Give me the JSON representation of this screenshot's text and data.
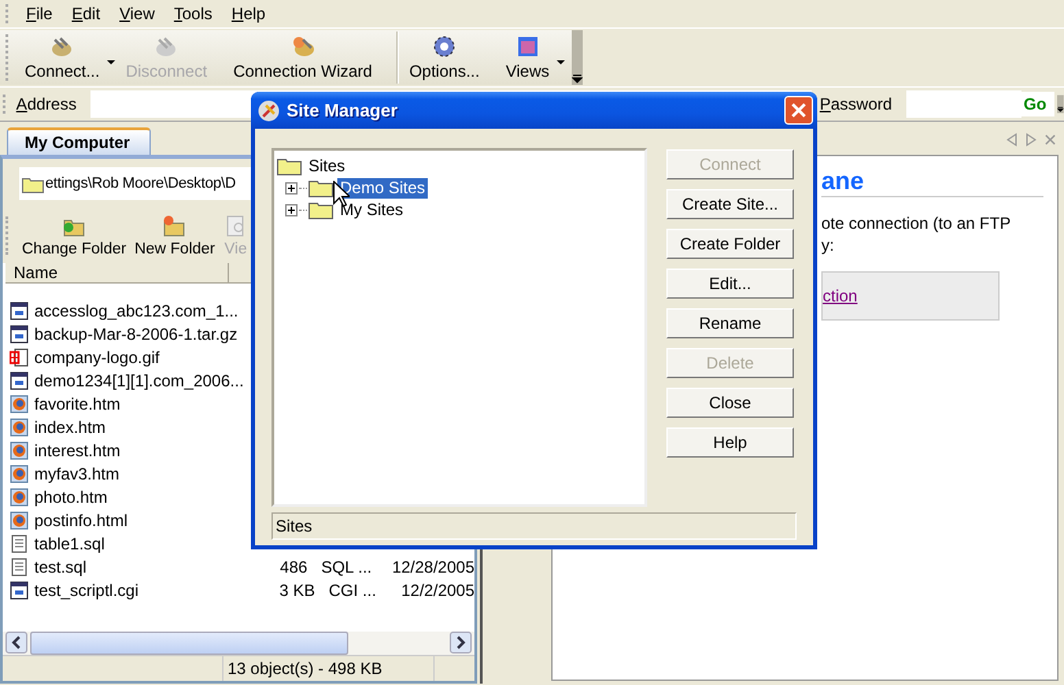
{
  "menu": [
    {
      "label": "File"
    },
    {
      "label": "Edit"
    },
    {
      "label": "View"
    },
    {
      "label": "Tools"
    },
    {
      "label": "Help"
    }
  ],
  "toolbar": [
    {
      "label": "Connect...",
      "kind": "connect",
      "disabled": false,
      "dropdown": true,
      "separator_before": false
    },
    {
      "label": "Disconnect",
      "kind": "disconnect",
      "disabled": true,
      "dropdown": false,
      "separator_before": false
    },
    {
      "label": "Connection Wizard",
      "kind": "wizard",
      "disabled": false,
      "dropdown": false,
      "separator_before": false
    },
    {
      "label": "Options...",
      "kind": "options",
      "disabled": false,
      "dropdown": false,
      "separator_before": true
    },
    {
      "label": "Views",
      "kind": "views",
      "disabled": false,
      "dropdown": true,
      "separator_before": false
    }
  ],
  "address_bar": {
    "address_label": "Address",
    "password_label": "Password",
    "go": "Go"
  },
  "local_pane": {
    "tab": "My Computer",
    "path": "ettings\\Rob Moore\\Desktop\\D",
    "toolbar": [
      {
        "label": "Change Folder",
        "kind": "change",
        "disabled": false
      },
      {
        "label": "New Folder",
        "kind": "new",
        "disabled": false
      },
      {
        "label": "Vie",
        "kind": "view",
        "disabled": true
      }
    ],
    "columns": [
      "Name"
    ],
    "files": [
      {
        "name": "accesslog_abc123.com_1...",
        "kind": "script"
      },
      {
        "name": "backup-Mar-8-2006-1.tar.gz",
        "kind": "script"
      },
      {
        "name": "company-logo.gif",
        "kind": "image"
      },
      {
        "name": "demo1234[1][1].com_2006...",
        "kind": "script"
      },
      {
        "name": "favorite.htm",
        "kind": "web"
      },
      {
        "name": "index.htm",
        "kind": "web"
      },
      {
        "name": "interest.htm",
        "kind": "web"
      },
      {
        "name": "myfav3.htm",
        "kind": "web"
      },
      {
        "name": "photo.htm",
        "kind": "web"
      },
      {
        "name": "postinfo.html",
        "kind": "web"
      },
      {
        "name": "table1.sql",
        "kind": "text"
      },
      {
        "name": "test.sql",
        "kind": "text",
        "size": "486",
        "type": "SQL ...",
        "modified": "12/28/2005"
      },
      {
        "name": "test_scriptl.cgi",
        "kind": "script",
        "size": "3 KB",
        "type": "CGI ...",
        "modified": "12/2/2005"
      }
    ],
    "status": "13 object(s) - 498 KB"
  },
  "right_pane": {
    "heading": "ane",
    "text_lines": [
      "ote connection (to an FTP",
      "y:"
    ],
    "link": "ction"
  },
  "site_manager": {
    "title": "Site Manager",
    "tree": {
      "label": "Sites",
      "children": [
        {
          "label": "Demo Sites",
          "selected": true,
          "expanded": false
        },
        {
          "label": "My Sites",
          "selected": false,
          "expanded": false
        }
      ]
    },
    "buttons": [
      {
        "label": "Connect",
        "disabled": true
      },
      {
        "label": "Create Site...",
        "disabled": false
      },
      {
        "label": "Create Folder",
        "disabled": false
      },
      {
        "label": "Edit...",
        "disabled": false
      },
      {
        "label": "Rename",
        "disabled": false
      },
      {
        "label": "Delete",
        "disabled": true
      },
      {
        "label": "Close",
        "disabled": false
      },
      {
        "label": "Help",
        "disabled": false
      }
    ],
    "status": "Sites"
  }
}
